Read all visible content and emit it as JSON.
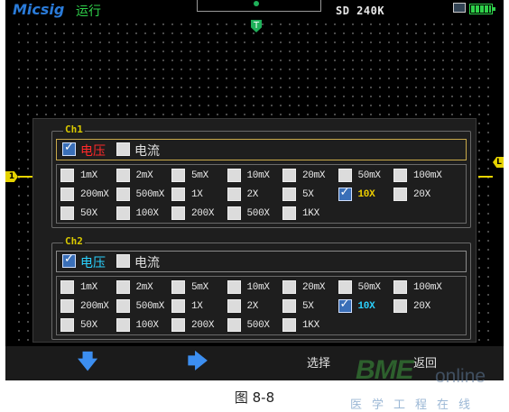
{
  "status_bar": {
    "brand": "Micsig",
    "run_state": "运行",
    "sample_info": "SD 240K"
  },
  "markers": {
    "trigger": "T",
    "ch1_left": "1",
    "ch1_right": "L"
  },
  "dialog": {
    "channels": [
      {
        "title": "Ch1",
        "types": [
          {
            "label": "电压",
            "checked": true
          },
          {
            "label": "电流",
            "checked": false
          }
        ],
        "probe_options": [
          "1mX",
          "2mX",
          "5mX",
          "10mX",
          "20mX",
          "50mX",
          "100mX",
          "200mX",
          "500mX",
          "1X",
          "2X",
          "5X",
          "10X",
          "20X",
          "50X",
          "100X",
          "200X",
          "500X",
          "1KX"
        ],
        "selected_probe": "10X",
        "accent": "#f0d000"
      },
      {
        "title": "Ch2",
        "types": [
          {
            "label": "电压",
            "checked": true
          },
          {
            "label": "电流",
            "checked": false
          }
        ],
        "probe_options": [
          "1mX",
          "2mX",
          "5mX",
          "10mX",
          "20mX",
          "50mX",
          "100mX",
          "200mX",
          "500mX",
          "1X",
          "2X",
          "5X",
          "10X",
          "20X",
          "50X",
          "100X",
          "200X",
          "500X",
          "1KX"
        ],
        "selected_probe": "10X",
        "accent": "#2bd2ff"
      }
    ]
  },
  "softkeys": [
    {
      "icon": "down-arrow-icon",
      "glyph": "🡇"
    },
    {
      "icon": "right-arrow-icon",
      "glyph": "🡆"
    },
    {
      "label": "选择"
    },
    {
      "label": "返回"
    }
  ],
  "caption": "图 8-8",
  "watermark": {
    "brand": "BME",
    "online": "online",
    "subtitle": "医学工程在线"
  },
  "colors": {
    "ch1": "#e6d300",
    "ch2": "#2bd2ff",
    "trigger": "#1fb15a",
    "brand": "#2a7bd9"
  }
}
